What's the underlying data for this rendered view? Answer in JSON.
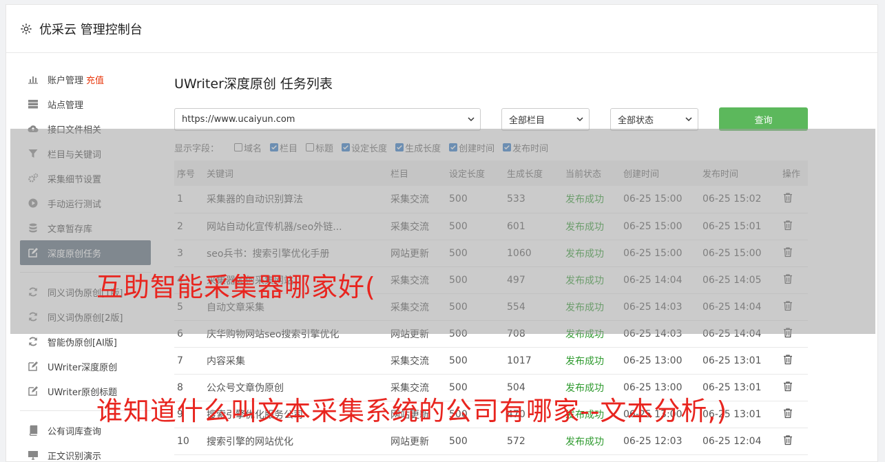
{
  "header": {
    "title": "优采云 管理控制台",
    "icon": "gear-icon"
  },
  "sidebar": {
    "groups": [
      [
        {
          "label": "账户管理",
          "badge": "充值",
          "icon": "bar-chart-icon"
        },
        {
          "label": "站点管理",
          "icon": "server-icon"
        },
        {
          "label": "接口文件相关",
          "icon": "cloud-upload-icon"
        },
        {
          "label": "栏目与关键词",
          "icon": "filter-icon"
        },
        {
          "label": "采集细节设置",
          "icon": "gears-icon"
        },
        {
          "label": "手动运行测试",
          "icon": "play-circle-icon"
        },
        {
          "label": "文章暂存库",
          "icon": "database-icon"
        },
        {
          "label": "深度原创任务",
          "icon": "edit-icon",
          "active": true
        }
      ],
      [
        {
          "label": "同义词伪原创[1版]",
          "icon": "refresh-icon"
        },
        {
          "label": "同义词伪原创[2版]",
          "icon": "refresh-icon"
        },
        {
          "label": "智能伪原创[AI版]",
          "icon": "refresh-icon"
        },
        {
          "label": "UWriter深度原创",
          "icon": "edit-icon"
        },
        {
          "label": "UWriter原创标题",
          "icon": "edit-icon"
        }
      ],
      [
        {
          "label": "公有词库查询",
          "icon": "book-icon"
        },
        {
          "label": "正文识别演示",
          "icon": "monitor-icon"
        }
      ]
    ]
  },
  "main": {
    "title": "UWriter深度原创 任务列表",
    "filters": {
      "site": "https://www.ucaiyun.com",
      "column": "全部栏目",
      "status": "全部状态",
      "query_label": "查询"
    },
    "fields_label": "显示字段：",
    "fields": [
      {
        "label": "域名",
        "checked": false
      },
      {
        "label": "栏目",
        "checked": true
      },
      {
        "label": "标题",
        "checked": false
      },
      {
        "label": "设定长度",
        "checked": true
      },
      {
        "label": "生成长度",
        "checked": true
      },
      {
        "label": "创建时间",
        "checked": true
      },
      {
        "label": "发布时间",
        "checked": true
      }
    ],
    "columns": [
      "序号",
      "关键词",
      "栏目",
      "设定长度",
      "生成长度",
      "当前状态",
      "创建时间",
      "发布时间",
      "操作"
    ],
    "rows": [
      [
        "1",
        "采集器的自动识别算法",
        "采集交流",
        "500",
        "533",
        "发布成功",
        "06-25 15:00",
        "06-25 15:02"
      ],
      [
        "2",
        "网站自动化宣传机器/seo外链...",
        "采集交流",
        "500",
        "601",
        "发布成功",
        "06-25 15:00",
        "06-25 15:01"
      ],
      [
        "3",
        "seo兵书：搜索引擎优化手册",
        "网站更新",
        "500",
        "1060",
        "发布成功",
        "06-25 15:00",
        "06-25 15:00"
      ],
      [
        "4",
        "采集器如何采集网站",
        "采集交流",
        "500",
        "497",
        "发布成功",
        "06-25 14:04",
        "06-25 14:05"
      ],
      [
        "5",
        "自动文章采集",
        "采集交流",
        "500",
        "554",
        "发布成功",
        "06-25 14:03",
        "06-25 14:04"
      ],
      [
        "6",
        "庆华购物网站seo搜索引擎优化",
        "网站更新",
        "500",
        "708",
        "发布成功",
        "06-25 14:03",
        "06-25 14:04"
      ],
      [
        "7",
        "内容采集",
        "采集交流",
        "500",
        "1017",
        "发布成功",
        "06-25 13:00",
        "06-25 13:01"
      ],
      [
        "8",
        "公众号文章伪原创",
        "采集交流",
        "500",
        "504",
        "发布成功",
        "06-25 13:00",
        "06-25 13:01"
      ],
      [
        "9",
        "搜索引擎优化服务公司",
        "网站更新",
        "500",
        "470",
        "发布成功",
        "06-25 13:00",
        "06-25 13:01"
      ],
      [
        "10",
        "搜索引擎的网站优化",
        "网站更新",
        "500",
        "572",
        "发布成功",
        "06-25 12:03",
        "06-25 12:04"
      ]
    ]
  },
  "watermarks": {
    "line1": "互助智能采集器哪家好(",
    "line2": "谁知道什么叫文本采集系统的公司有哪家--文本分析,)"
  },
  "colors": {
    "accent_green": "#5cb85c",
    "active_nav": "#5a6b7b",
    "badge_red": "#e8380d",
    "status_ok": "#2e9a2e",
    "watermark": "#e8251f"
  }
}
